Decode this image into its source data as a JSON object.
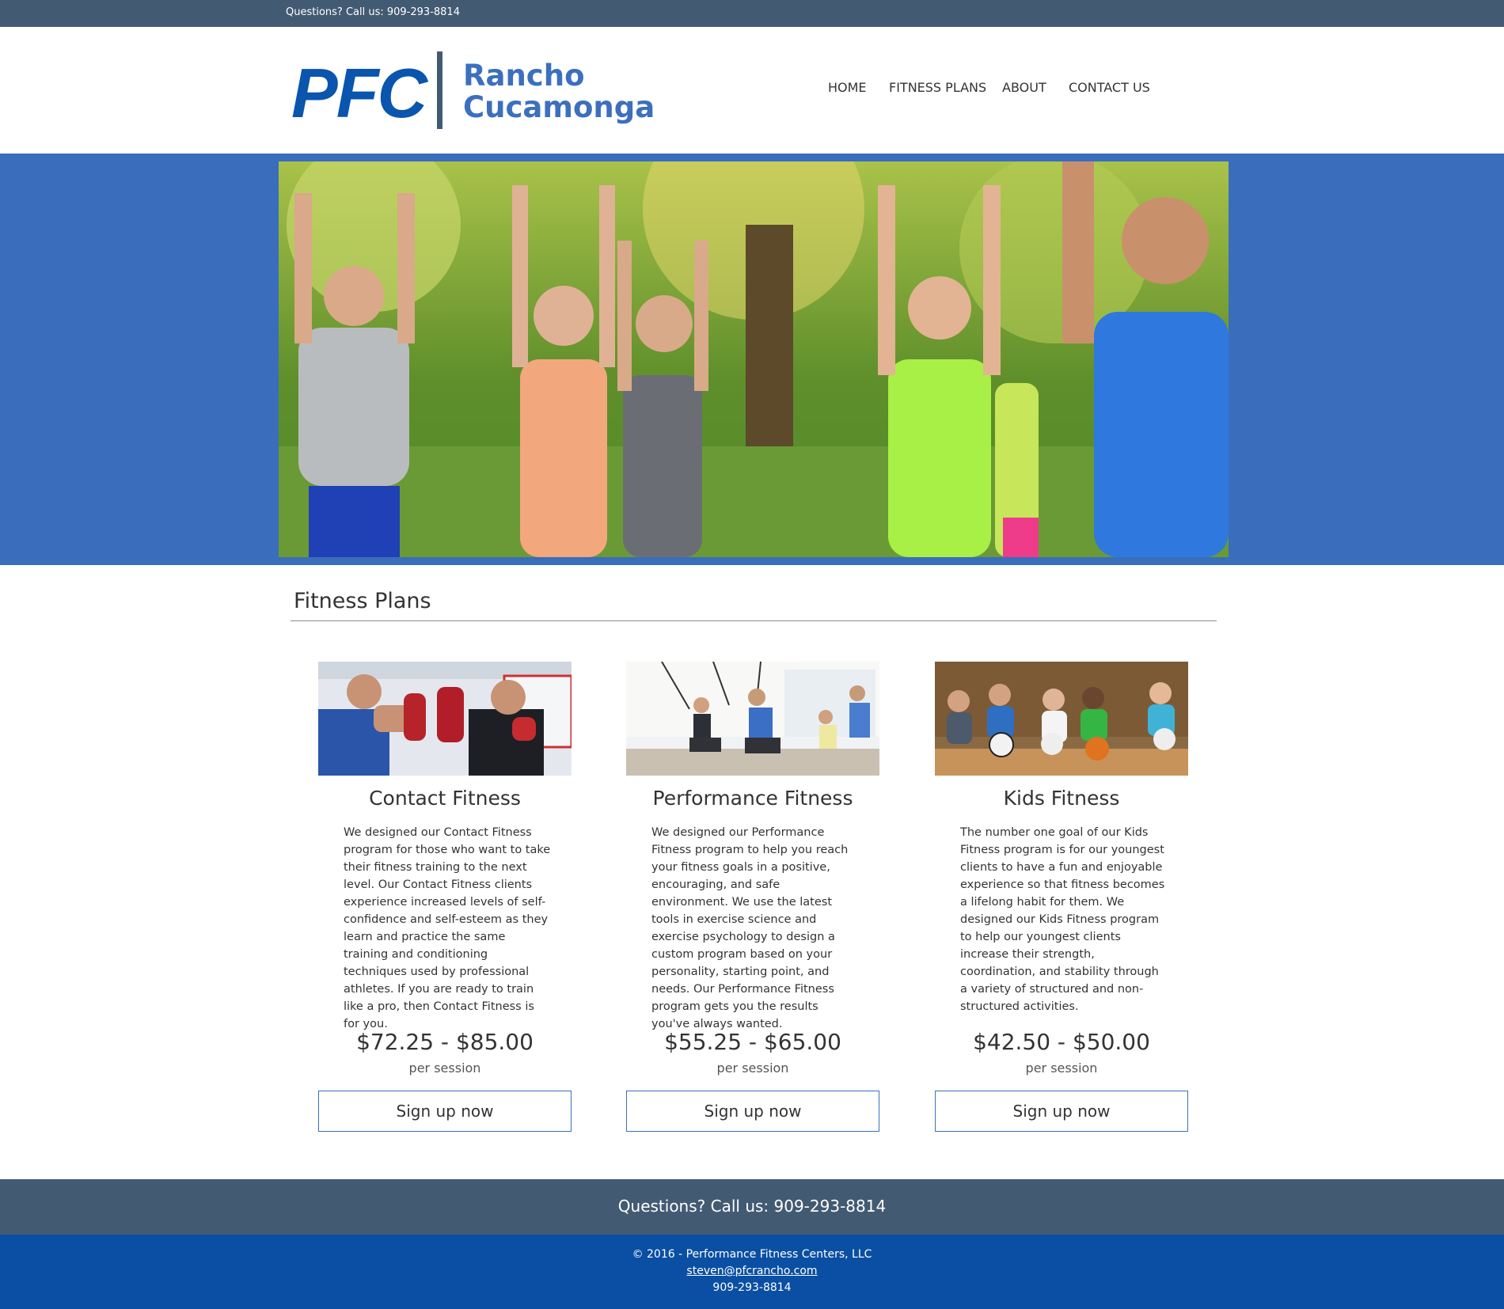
{
  "topbar": {
    "phone": "Questions? Call us: 909-293-8814"
  },
  "logo": {
    "brand": "PFC",
    "city_line1": "Rancho",
    "city_line2": "Cucamonga"
  },
  "nav": [
    "HOME",
    "FITNESS PLANS",
    "ABOUT",
    "CONTACT US"
  ],
  "section": {
    "title": "Fitness Plans"
  },
  "plans": [
    {
      "title": "Contact Fitness",
      "description": "We designed our Contact Fitness program for those who want to take their fitness training to the next level. Our Contact Fitness clients experience increased levels of self-confidence and self-esteem as they learn and practice the same training and conditioning techniques used by professional athletes. If you are ready to train like a pro, then Contact Fitness is for you.",
      "price": "$72.25 - $85.00",
      "unit": "per session",
      "button": "Sign up now"
    },
    {
      "title": "Performance Fitness",
      "description": "We designed our Performance Fitness program to help you reach your fitness goals in a positive, encouraging, and safe environment. We use the latest tools in exercise science and exercise psychology to design a custom program based on your personality, starting point, and needs. Our Performance Fitness program gets you the results you've always wanted.",
      "price": "$55.25 - $65.00",
      "unit": "per session",
      "button": "Sign up now"
    },
    {
      "title": "Kids Fitness",
      "description": "The number one goal of our Kids Fitness program is for our youngest clients to have a fun and enjoyable experience so that fitness becomes a lifelong habit for them. We designed our Kids Fitness program to help our youngest clients increase their strength, coordination, and stability through a variety of structured and non-structured activities.",
      "price": "$42.50 - $50.00",
      "unit": "per session",
      "button": "Sign up now"
    }
  ],
  "footer": {
    "question": "Questions? Call us: 909-293-8814",
    "copyright": "© 2016 - Performance Fitness Centers, LLC",
    "email": "steven@pfcrancho.com",
    "phone": "909-293-8814"
  },
  "colors": {
    "slate": "#435a73",
    "blue": "#3a6dbb",
    "brand": "#0a55ad",
    "footer_blue": "#0a4fa3"
  }
}
